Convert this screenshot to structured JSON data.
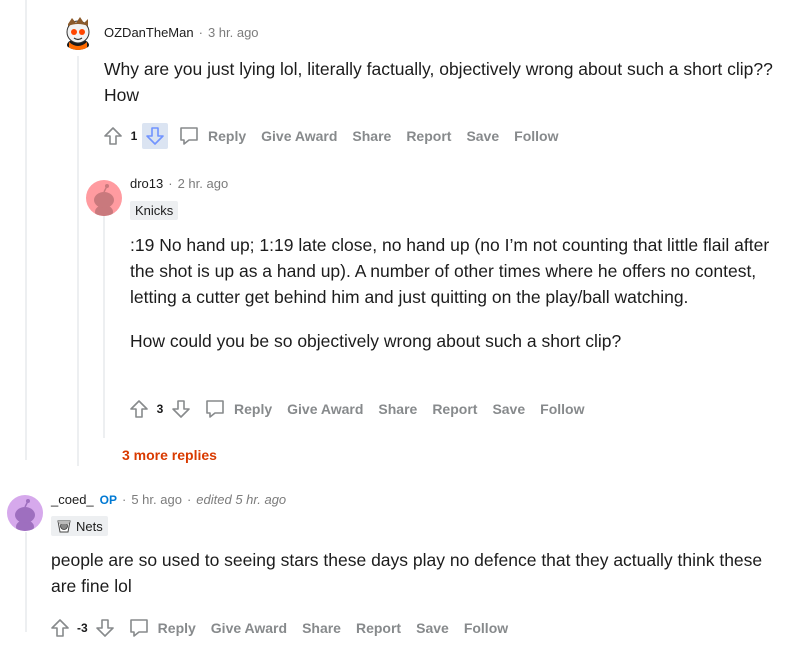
{
  "comments": [
    {
      "username": "OZDanTheMan",
      "time": "3 hr. ago",
      "body": [
        "Why are you just lying lol, literally factually, objectively wrong about such a short clip?? How"
      ],
      "score": "1",
      "actions": {
        "reply": "Reply",
        "give_award": "Give Award",
        "share": "Share",
        "report": "Report",
        "save": "Save",
        "follow": "Follow"
      }
    },
    {
      "username": "dro13",
      "time": "2 hr. ago",
      "flair": "Knicks",
      "body": [
        ":19 No hand up; 1:19 late close, no hand up (no I’m not counting that little flail after the shot is up as a hand up). A number of other times where he offers no contest, letting a cutter get behind him and just quitting on the play/ball watching.",
        "How could you be so objectively wrong about such a short clip?"
      ],
      "score": "3",
      "actions": {
        "reply": "Reply",
        "give_award": "Give Award",
        "share": "Share",
        "report": "Report",
        "save": "Save",
        "follow": "Follow"
      },
      "more_replies": "3 more replies"
    },
    {
      "username": "_coed_",
      "op_badge": "OP",
      "time": "5 hr. ago",
      "edited": "edited 5 hr. ago",
      "flair": "Nets",
      "body": [
        "people are so used to seeing stars these days play no defence that they actually think these are fine lol"
      ],
      "score": "-3",
      "actions": {
        "reply": "Reply",
        "give_award": "Give Award",
        "share": "Share",
        "report": "Report",
        "save": "Save",
        "follow": "Follow"
      }
    }
  ],
  "colors": {
    "downvote_active": "#7193ff",
    "op": "#0079d3",
    "more_replies": "#d93a00",
    "muted": "#878a8c"
  }
}
